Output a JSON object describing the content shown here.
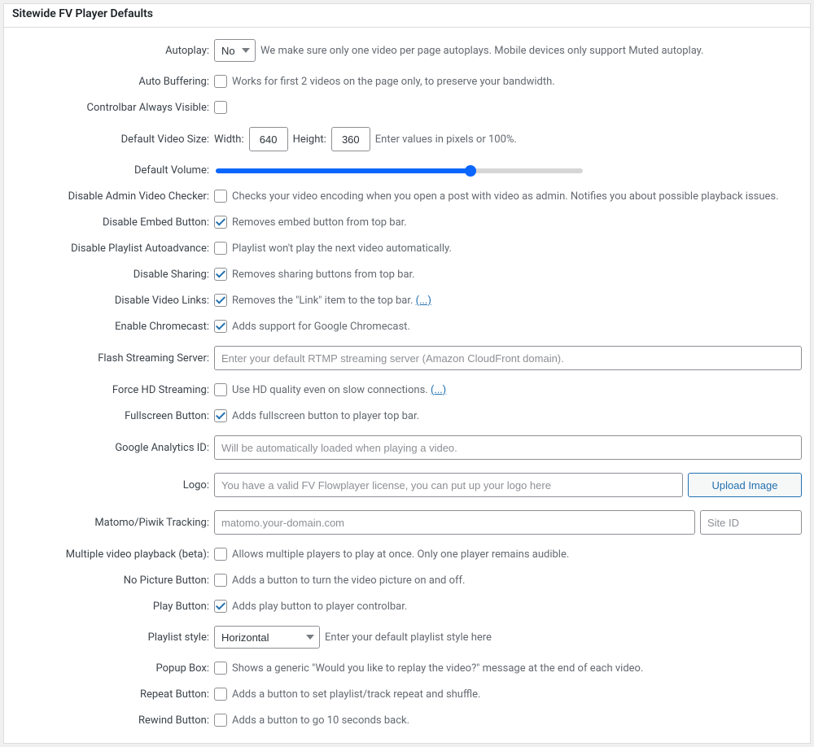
{
  "panel": {
    "title": "Sitewide FV Player Defaults"
  },
  "autoplay": {
    "label": "Autoplay:",
    "value": "No",
    "options": [
      "No"
    ],
    "desc": "We make sure only one video per page autoplays. Mobile devices only support Muted autoplay."
  },
  "auto_buffering": {
    "label": "Auto Buffering:",
    "checked": false,
    "desc": "Works for first 2 videos on the page only, to preserve your bandwidth."
  },
  "controlbar_always_visible": {
    "label": "Controlbar Always Visible:",
    "checked": false
  },
  "default_video_size": {
    "label": "Default Video Size:",
    "width_label": "Width:",
    "width": "640",
    "height_label": "Height:",
    "height": "360",
    "desc": "Enter values in pixels or 100%."
  },
  "default_volume": {
    "label": "Default Volume:",
    "value": 70
  },
  "disable_admin_video_checker": {
    "label": "Disable Admin Video Checker:",
    "checked": false,
    "desc": "Checks your video encoding when you open a post with video as admin. Notifies you about possible playback issues."
  },
  "disable_embed_button": {
    "label": "Disable Embed Button:",
    "checked": true,
    "desc": "Removes embed button from top bar."
  },
  "disable_playlist_autoadvance": {
    "label": "Disable Playlist Autoadvance:",
    "checked": false,
    "desc": "Playlist won't play the next video automatically."
  },
  "disable_sharing": {
    "label": "Disable Sharing:",
    "checked": true,
    "desc": "Removes sharing buttons from top bar."
  },
  "disable_video_links": {
    "label": "Disable Video Links:",
    "checked": true,
    "desc": "Removes the \"Link\" item to the top bar. ",
    "link": "(...)"
  },
  "enable_chromecast": {
    "label": "Enable Chromecast:",
    "checked": true,
    "desc": "Adds support for Google Chromecast."
  },
  "flash_streaming_server": {
    "label": "Flash Streaming Server:",
    "placeholder": "Enter your default RTMP streaming server (Amazon CloudFront domain)."
  },
  "force_hd_streaming": {
    "label": "Force HD Streaming:",
    "checked": false,
    "desc": "Use HD quality even on slow connections. ",
    "link": "(...)"
  },
  "fullscreen_button": {
    "label": "Fullscreen Button:",
    "checked": true,
    "desc": "Adds fullscreen button to player top bar."
  },
  "google_analytics_id": {
    "label": "Google Analytics ID:",
    "placeholder": "Will be automatically loaded when playing a video."
  },
  "logo": {
    "label": "Logo:",
    "placeholder": "You have a valid FV Flowplayer license, you can put up your logo here",
    "button": "Upload Image"
  },
  "matomo_tracking": {
    "label": "Matomo/Piwik Tracking:",
    "placeholder": "matomo.your-domain.com",
    "site_id_placeholder": "Site ID"
  },
  "multiple_video_playback": {
    "label": "Multiple video playback (beta):",
    "checked": false,
    "desc": "Allows multiple players to play at once. Only one player remains audible."
  },
  "no_picture_button": {
    "label": "No Picture Button:",
    "checked": false,
    "desc": "Adds a button to turn the video picture on and off."
  },
  "play_button": {
    "label": "Play Button:",
    "checked": true,
    "desc": "Adds play button to player controlbar."
  },
  "playlist_style": {
    "label": "Playlist style:",
    "value": "Horizontal",
    "options": [
      "Horizontal"
    ],
    "desc": "Enter your default playlist style here"
  },
  "popup_box": {
    "label": "Popup Box:",
    "checked": false,
    "desc": "Shows a generic \"Would you like to replay the video?\" message at the end of each video."
  },
  "repeat_button": {
    "label": "Repeat Button:",
    "checked": false,
    "desc": "Adds a button to set playlist/track repeat and shuffle."
  },
  "rewind_button": {
    "label": "Rewind Button:",
    "checked": false,
    "desc": "Adds a button to go 10 seconds back."
  }
}
